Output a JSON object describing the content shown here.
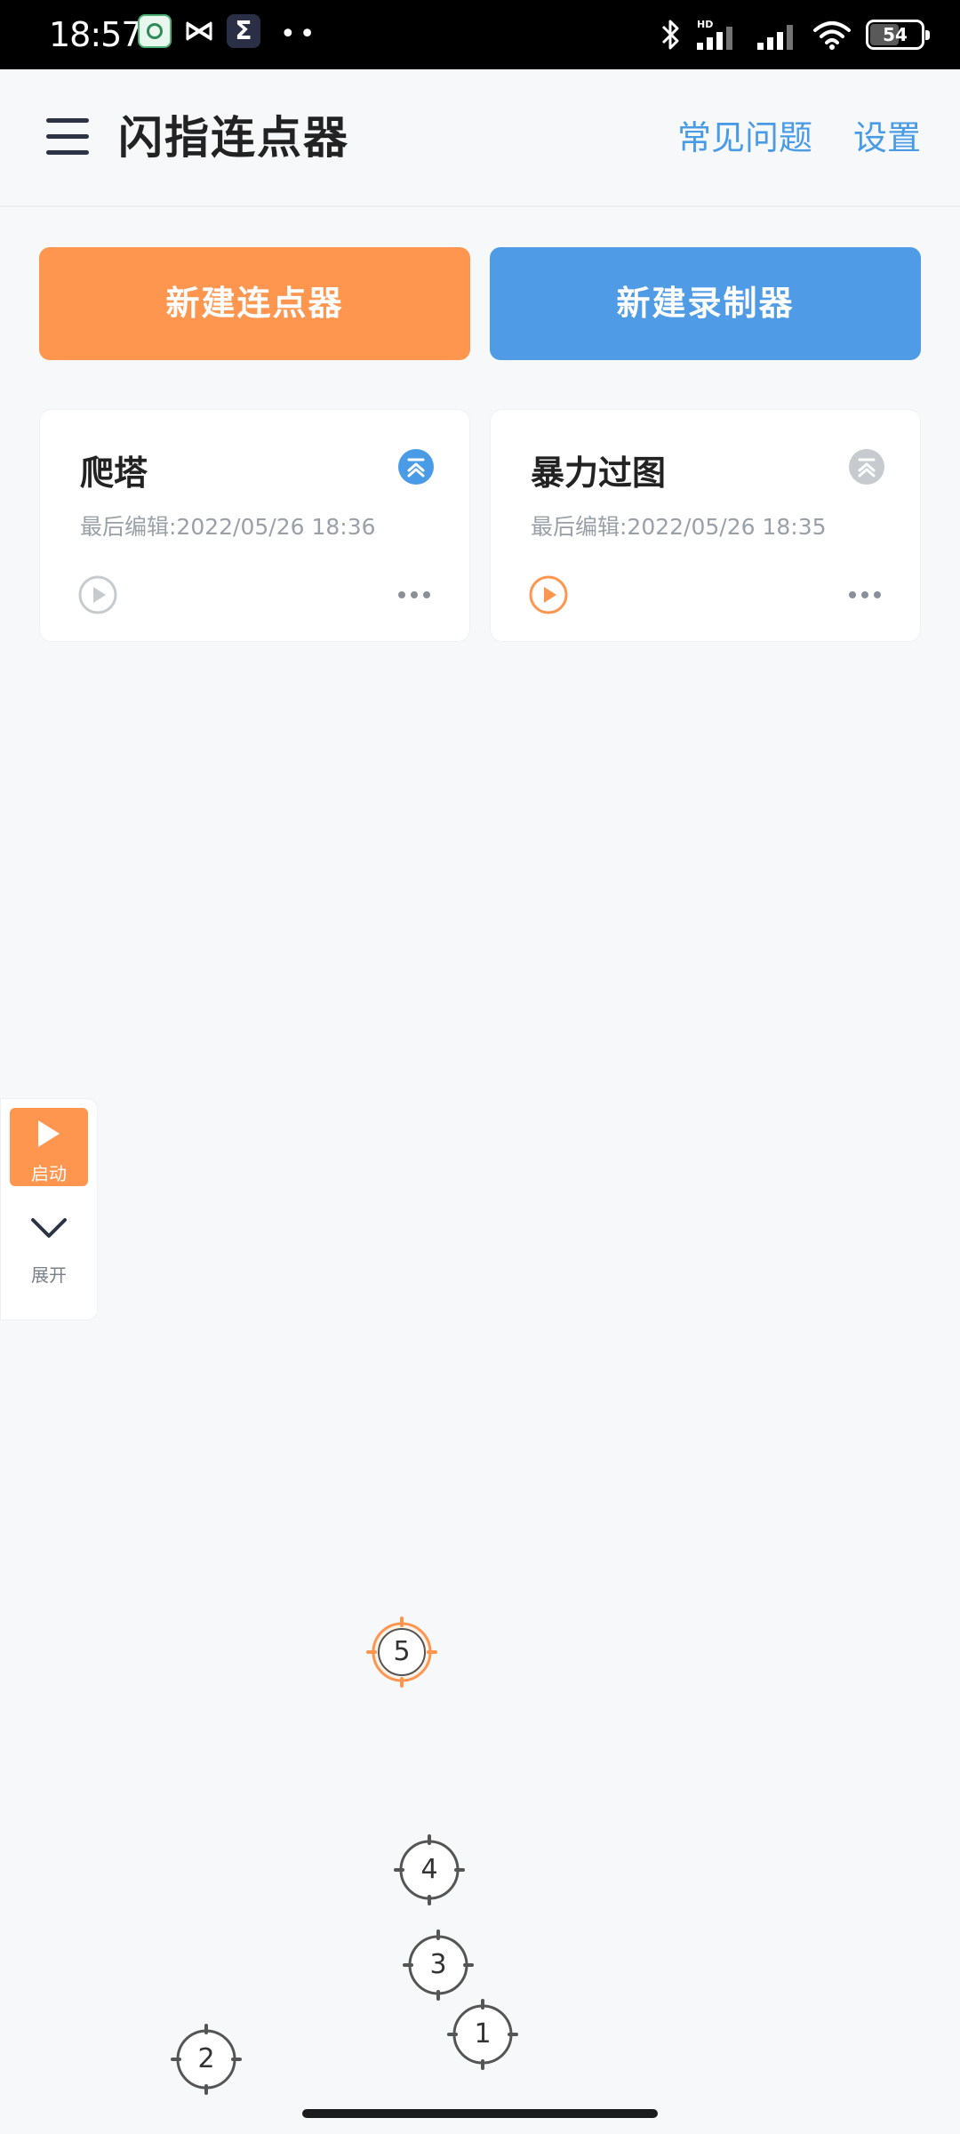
{
  "status_bar": {
    "time": "18:57",
    "battery": "54"
  },
  "header": {
    "title": "闪指连点器",
    "faq_label": "常见问题",
    "settings_label": "设置"
  },
  "actions": {
    "new_clicker": "新建连点器",
    "new_recorder": "新建录制器"
  },
  "cards": [
    {
      "title": "爬塔",
      "last_edited": "最后编辑:2022/05/26 18:36",
      "pinned": true
    },
    {
      "title": "暴力过图",
      "last_edited": "最后编辑:2022/05/26 18:35",
      "pinned": false
    }
  ],
  "float_panel": {
    "start_label": "启动",
    "expand_label": "展开"
  },
  "targets": [
    "1",
    "2",
    "3",
    "4",
    "5"
  ],
  "colors": {
    "orange": "#ff9650",
    "blue": "#4f9be5",
    "link": "#4a9be5",
    "muted": "#9aa0a8"
  }
}
